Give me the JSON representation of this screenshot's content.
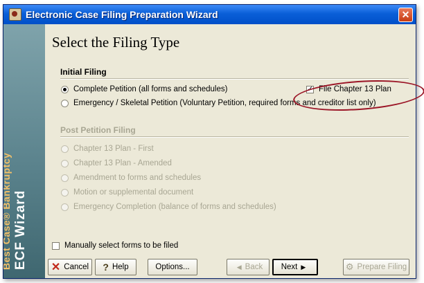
{
  "window": {
    "title": "Electronic Case Filing Preparation Wizard"
  },
  "sidebar": {
    "brand_line": "Best Case® Bankruptcy",
    "product_line": "ECF Wizard"
  },
  "page": {
    "heading": "Select the Filing Type"
  },
  "initial_filing": {
    "label": "Initial Filing",
    "options": [
      {
        "label": "Complete Petition  (all forms and schedules)",
        "checked": true
      },
      {
        "label": "Emergency / Skeletal Petition  (Voluntary Petition, required forms and creditor list only)",
        "checked": false
      }
    ],
    "file_chapter13_plan": {
      "label": "File Chapter 13 Plan",
      "checked": true
    }
  },
  "post_petition": {
    "label": "Post Petition Filing",
    "options": [
      {
        "label": "Chapter 13 Plan - First"
      },
      {
        "label": "Chapter 13 Plan - Amended"
      },
      {
        "label": "Amendment to forms and schedules"
      },
      {
        "label": "Motion or supplemental document"
      },
      {
        "label": "Emergency Completion  (balance of forms and schedules)"
      }
    ]
  },
  "manual_select": {
    "label": "Manually select forms to be filed",
    "checked": false
  },
  "buttons": {
    "cancel": "Cancel",
    "help": "Help",
    "options": "Options...",
    "back": "Back",
    "next": "Next",
    "prepare": "Prepare Filing"
  },
  "colors": {
    "titlebar": "#0a5fd8",
    "highlight": "#9b1526",
    "sidebar_brand": "#f3c06a"
  }
}
